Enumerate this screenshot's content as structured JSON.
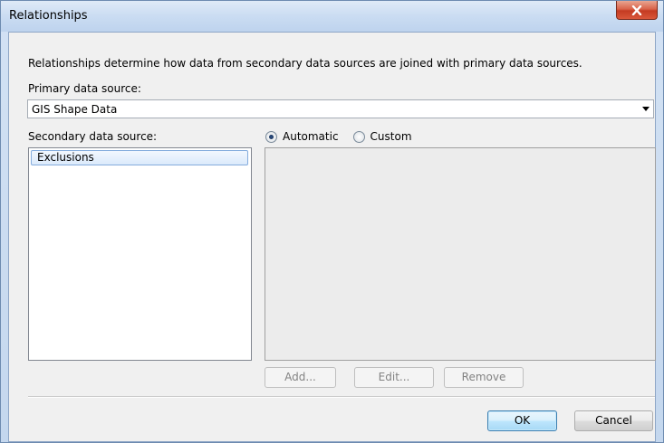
{
  "window": {
    "title": "Relationships"
  },
  "description": "Relationships determine how data from secondary data sources are joined with primary data sources.",
  "primary": {
    "label": "Primary data source:",
    "selected": "GIS Shape Data"
  },
  "secondary": {
    "label": "Secondary data source:",
    "items": [
      "Exclusions"
    ]
  },
  "mode": {
    "automatic_label": "Automatic",
    "custom_label": "Custom",
    "selected": "Automatic"
  },
  "buttons": {
    "add": "Add...",
    "edit": "Edit...",
    "remove": "Remove",
    "ok": "OK",
    "cancel": "Cancel"
  },
  "colors": {
    "close_button": "#c43b22",
    "selection_border": "#84acdd",
    "default_button_border": "#3c7fb1"
  },
  "icons": {
    "close": "close-icon",
    "dropdown": "chevron-down-icon"
  }
}
